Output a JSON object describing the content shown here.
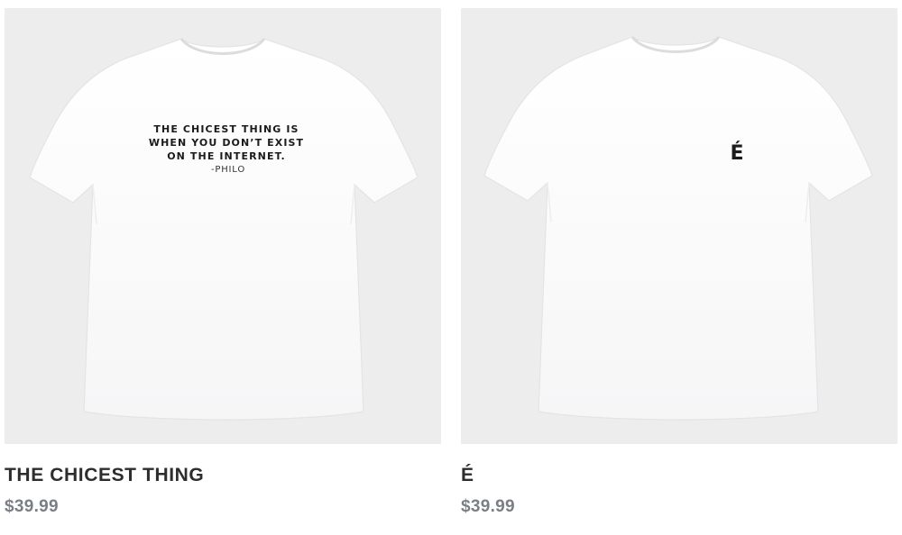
{
  "products": [
    {
      "name": "THE CHICEST THING",
      "price": "$39.99",
      "print_lines": [
        "THE CHICEST THING IS",
        "WHEN YOU DON’T EXIST",
        "ON THE INTERNET."
      ],
      "print_attribution": "-PHILO"
    },
    {
      "name": "É",
      "price": "$39.99",
      "print_logo": "É"
    }
  ],
  "colors": {
    "image_background": "#ededee",
    "shirt": "#ffffff",
    "name_text": "#2d2d2d",
    "price_text": "#7a7f86"
  }
}
